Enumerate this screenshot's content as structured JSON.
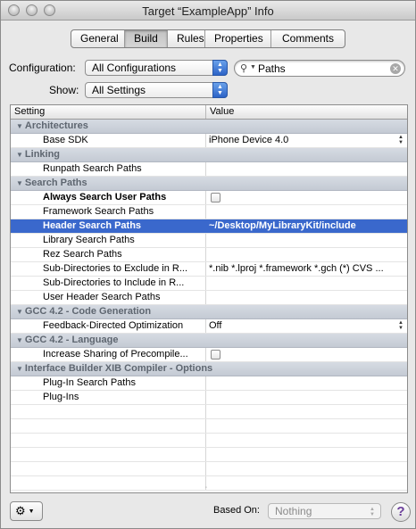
{
  "window": {
    "title": "Target “ExampleApp” Info"
  },
  "tabs": [
    {
      "label": "General"
    },
    {
      "label": "Build"
    },
    {
      "label": "Rules"
    },
    {
      "label": "Properties"
    },
    {
      "label": "Comments"
    }
  ],
  "config": {
    "configuration_label": "Configuration:",
    "configuration_value": "All Configurations",
    "show_label": "Show:",
    "show_value": "All Settings",
    "search_value": "Paths"
  },
  "table": {
    "col_setting": "Setting",
    "col_value": "Value",
    "groups": {
      "architectures": "Architectures",
      "linking": "Linking",
      "search_paths": "Search Paths",
      "gcc_codegen": "GCC 4.2 - Code Generation",
      "gcc_language": "GCC 4.2 - Language",
      "ib_xib": "Interface Builder XIB Compiler - Options"
    },
    "rows": {
      "base_sdk": {
        "setting": "Base SDK",
        "value": "iPhone Device 4.0"
      },
      "runpath": {
        "setting": "Runpath Search Paths",
        "value": ""
      },
      "always_search": {
        "setting": "Always Search User Paths"
      },
      "framework": {
        "setting": "Framework Search Paths",
        "value": ""
      },
      "header": {
        "setting": "Header Search Paths",
        "value": "~/Desktop/MyLibraryKit/include"
      },
      "library": {
        "setting": "Library Search Paths",
        "value": ""
      },
      "rez": {
        "setting": "Rez Search Paths",
        "value": ""
      },
      "subdir_exclude": {
        "setting": "Sub-Directories to Exclude in R...",
        "value": "*.nib *.lproj *.framework *.gch (*) CVS ..."
      },
      "subdir_include": {
        "setting": "Sub-Directories to Include in R...",
        "value": ""
      },
      "user_header": {
        "setting": "User Header Search Paths",
        "value": ""
      },
      "feedback": {
        "setting": "Feedback-Directed Optimization",
        "value": "Off"
      },
      "increase_sharing": {
        "setting": "Increase Sharing of Precompile..."
      },
      "plugin_search": {
        "setting": "Plug-In Search Paths",
        "value": ""
      },
      "plugins": {
        "setting": "Plug-Ins",
        "value": ""
      }
    }
  },
  "bottom": {
    "based_on_label": "Based On:",
    "based_on_value": "Nothing",
    "help_label": "?"
  }
}
